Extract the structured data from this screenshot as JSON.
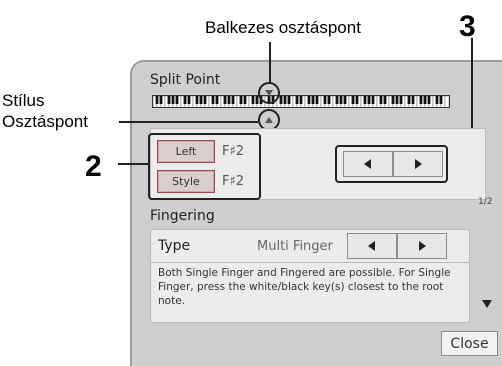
{
  "annotations": {
    "top_label": "Balkezes osztáspont",
    "left_label_line1": "Stílus",
    "left_label_line2": "Osztáspont",
    "callout_2": "2",
    "callout_3": "3"
  },
  "split_point": {
    "title": "Split Point",
    "left_button": "Left",
    "left_value": "F♯2",
    "style_button": "Style",
    "style_value": "F♯2",
    "left_arrow_icon": "triangle-left-icon",
    "right_arrow_icon": "triangle-right-icon"
  },
  "page_indicator": "1/2",
  "fingering": {
    "title": "Fingering",
    "type_label": "Type",
    "type_value": "Multi Finger",
    "description": "Both Single Finger and Fingered are possible. For Single Finger, press the white/black key(s) closest to the root note."
  },
  "close_button": "Close",
  "scroll_down_icon": "triangle-down-icon"
}
